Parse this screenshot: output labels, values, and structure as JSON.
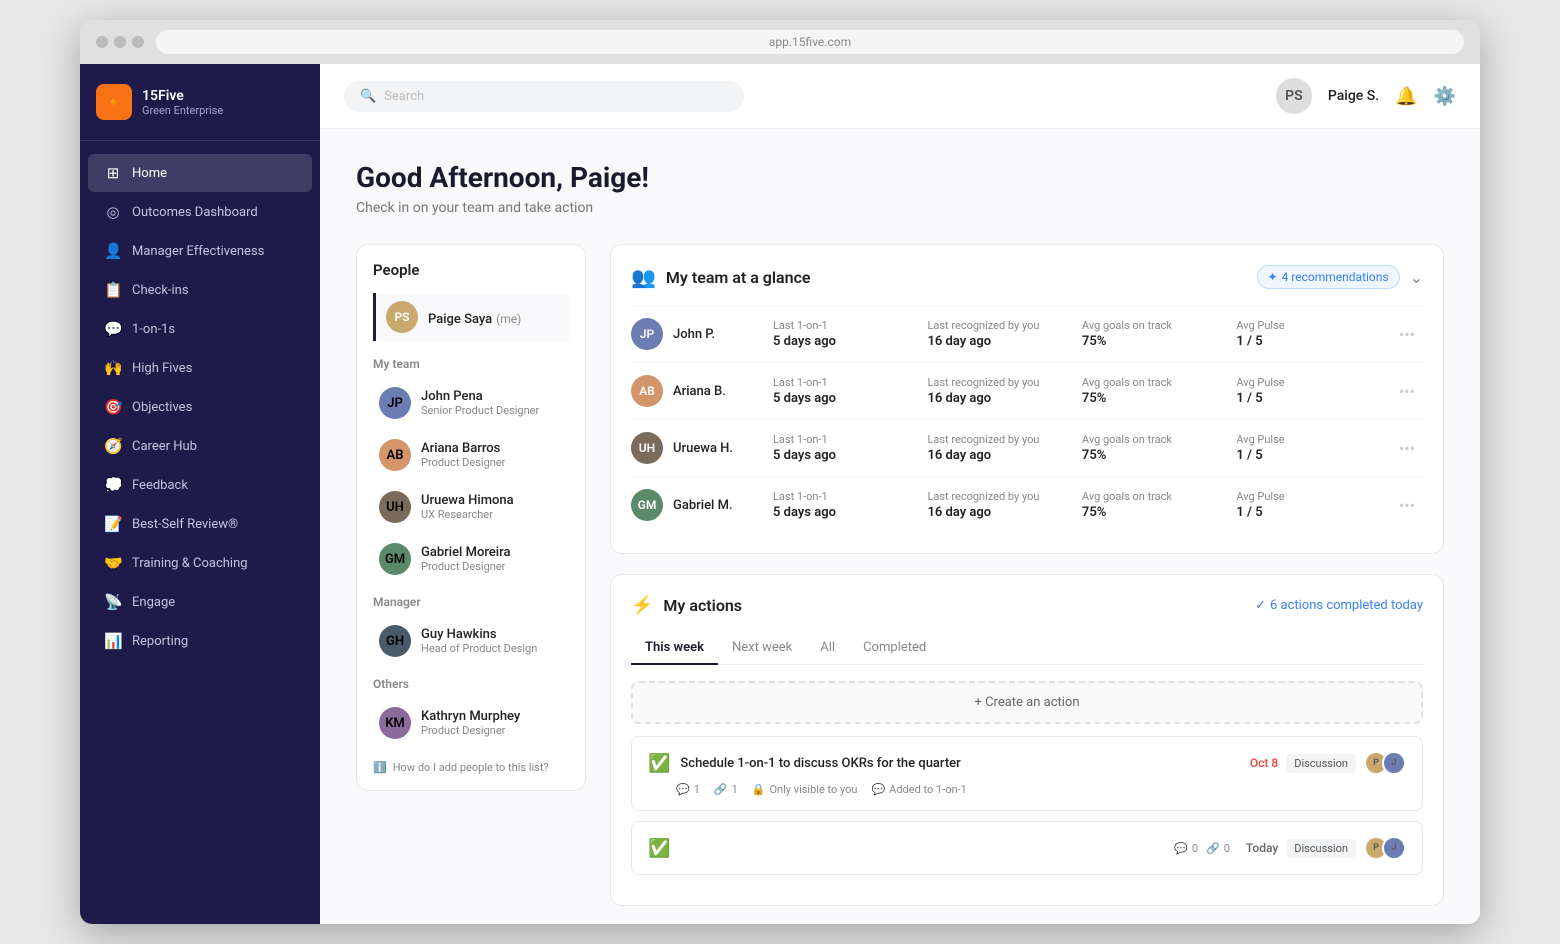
{
  "browser": {
    "address": "app.15five.com"
  },
  "app": {
    "logo_icon": "🔸",
    "company_name": "15Five",
    "company_tier": "Green Enterprise"
  },
  "sidebar": {
    "items": [
      {
        "id": "home",
        "label": "Home",
        "icon": "⊞",
        "active": true
      },
      {
        "id": "outcomes",
        "label": "Outcomes Dashboard",
        "icon": "◎",
        "active": false
      },
      {
        "id": "manager",
        "label": "Manager Effectiveness",
        "icon": "👤",
        "active": false
      },
      {
        "id": "checkins",
        "label": "Check-ins",
        "icon": "📋",
        "active": false
      },
      {
        "id": "1on1s",
        "label": "1-on-1s",
        "icon": "💬",
        "active": false
      },
      {
        "id": "highfives",
        "label": "High Fives",
        "icon": "🙌",
        "active": false
      },
      {
        "id": "objectives",
        "label": "Objectives",
        "icon": "🎯",
        "active": false
      },
      {
        "id": "careerhub",
        "label": "Career Hub",
        "icon": "🧭",
        "active": false
      },
      {
        "id": "feedback",
        "label": "Feedback",
        "icon": "💭",
        "active": false
      },
      {
        "id": "bestself",
        "label": "Best-Self Review®",
        "icon": "📝",
        "active": false
      },
      {
        "id": "training",
        "label": "Training & Coaching",
        "icon": "🤝",
        "active": false
      },
      {
        "id": "engage",
        "label": "Engage",
        "icon": "📡",
        "active": false
      },
      {
        "id": "reporting",
        "label": "Reporting",
        "icon": "📊",
        "active": false
      }
    ]
  },
  "header": {
    "search_placeholder": "Search",
    "user_name": "Paige S.",
    "user_initials": "PS"
  },
  "page": {
    "greeting": "Good Afternoon, Paige!",
    "subtitle": "Check in on your team and take action"
  },
  "people_panel": {
    "title": "People",
    "current_user": {
      "name": "Paige Saya",
      "badge": "(me)",
      "initials": "PS",
      "color": "#c9a96e"
    },
    "my_team_label": "My team",
    "team_members": [
      {
        "name": "John Pena",
        "role": "Senior Product Designer",
        "initials": "JP",
        "color": "#6b7db3"
      },
      {
        "name": "Ariana Barros",
        "role": "Product Designer",
        "initials": "AB",
        "color": "#d4956b"
      },
      {
        "name": "Uruewa Himona",
        "role": "UX Researcher",
        "initials": "UH",
        "color": "#7a6b5a"
      },
      {
        "name": "Gabriel Moreira",
        "role": "Product Designer",
        "initials": "GM",
        "color": "#5b8a6b"
      }
    ],
    "manager_label": "Manager",
    "manager": {
      "name": "Guy Hawkins",
      "role": "Head of Product Design",
      "initials": "GH",
      "color": "#4a5a6b"
    },
    "others_label": "Others",
    "others": [
      {
        "name": "Kathryn Murphey",
        "role": "Product Designer",
        "initials": "KM",
        "color": "#8b6b9b"
      }
    ],
    "help_text": "How do I add people to this list?"
  },
  "team_glance": {
    "title": "My team at a glance",
    "recommendations_count": "4 recommendations",
    "columns": {
      "last_1on1": "Last 1-on-1",
      "last_recognized": "Last recognized by you",
      "avg_goals": "Avg goals on track",
      "avg_pulse": "Avg Pulse"
    },
    "members": [
      {
        "name": "John P.",
        "initials": "JP",
        "color": "#6b7db3",
        "last_1on1": "5 days ago",
        "last_recognized": "16 day ago",
        "avg_goals": "75%",
        "avg_pulse": "1 / 5"
      },
      {
        "name": "Ariana B.",
        "initials": "AB",
        "color": "#d4956b",
        "last_1on1": "5 days ago",
        "last_recognized": "16 day ago",
        "avg_goals": "75%",
        "avg_pulse": "1 / 5"
      },
      {
        "name": "Uruewa H.",
        "initials": "UH",
        "color": "#7a6b5a",
        "last_1on1": "5 days ago",
        "last_recognized": "16 day ago",
        "avg_goals": "75%",
        "avg_pulse": "1 / 5"
      },
      {
        "name": "Gabriel M.",
        "initials": "GM",
        "color": "#5b8a6b",
        "last_1on1": "5 days ago",
        "last_recognized": "16 day ago",
        "avg_goals": "75%",
        "avg_pulse": "1 / 5"
      }
    ]
  },
  "my_actions": {
    "title": "My actions",
    "completed_text": "6 actions completed today",
    "tabs": [
      {
        "label": "This week",
        "active": true
      },
      {
        "label": "Next week",
        "active": false
      },
      {
        "label": "All",
        "active": false
      },
      {
        "label": "Completed",
        "active": false
      }
    ],
    "create_btn": "+ Create an action",
    "actions": [
      {
        "id": 1,
        "text": "Schedule 1-on-1 to discuss OKRs for the quarter",
        "comments": "1",
        "links": "1",
        "visibility": "Only visible to you",
        "added_to": "Added to 1-on-1",
        "date": "Oct 8",
        "type": "Discussion",
        "checked": true
      },
      {
        "id": 2,
        "text": "",
        "comments": "0",
        "links": "0",
        "visibility": "",
        "added_to": "",
        "date": "Today",
        "type": "Discussion",
        "checked": true
      }
    ]
  }
}
